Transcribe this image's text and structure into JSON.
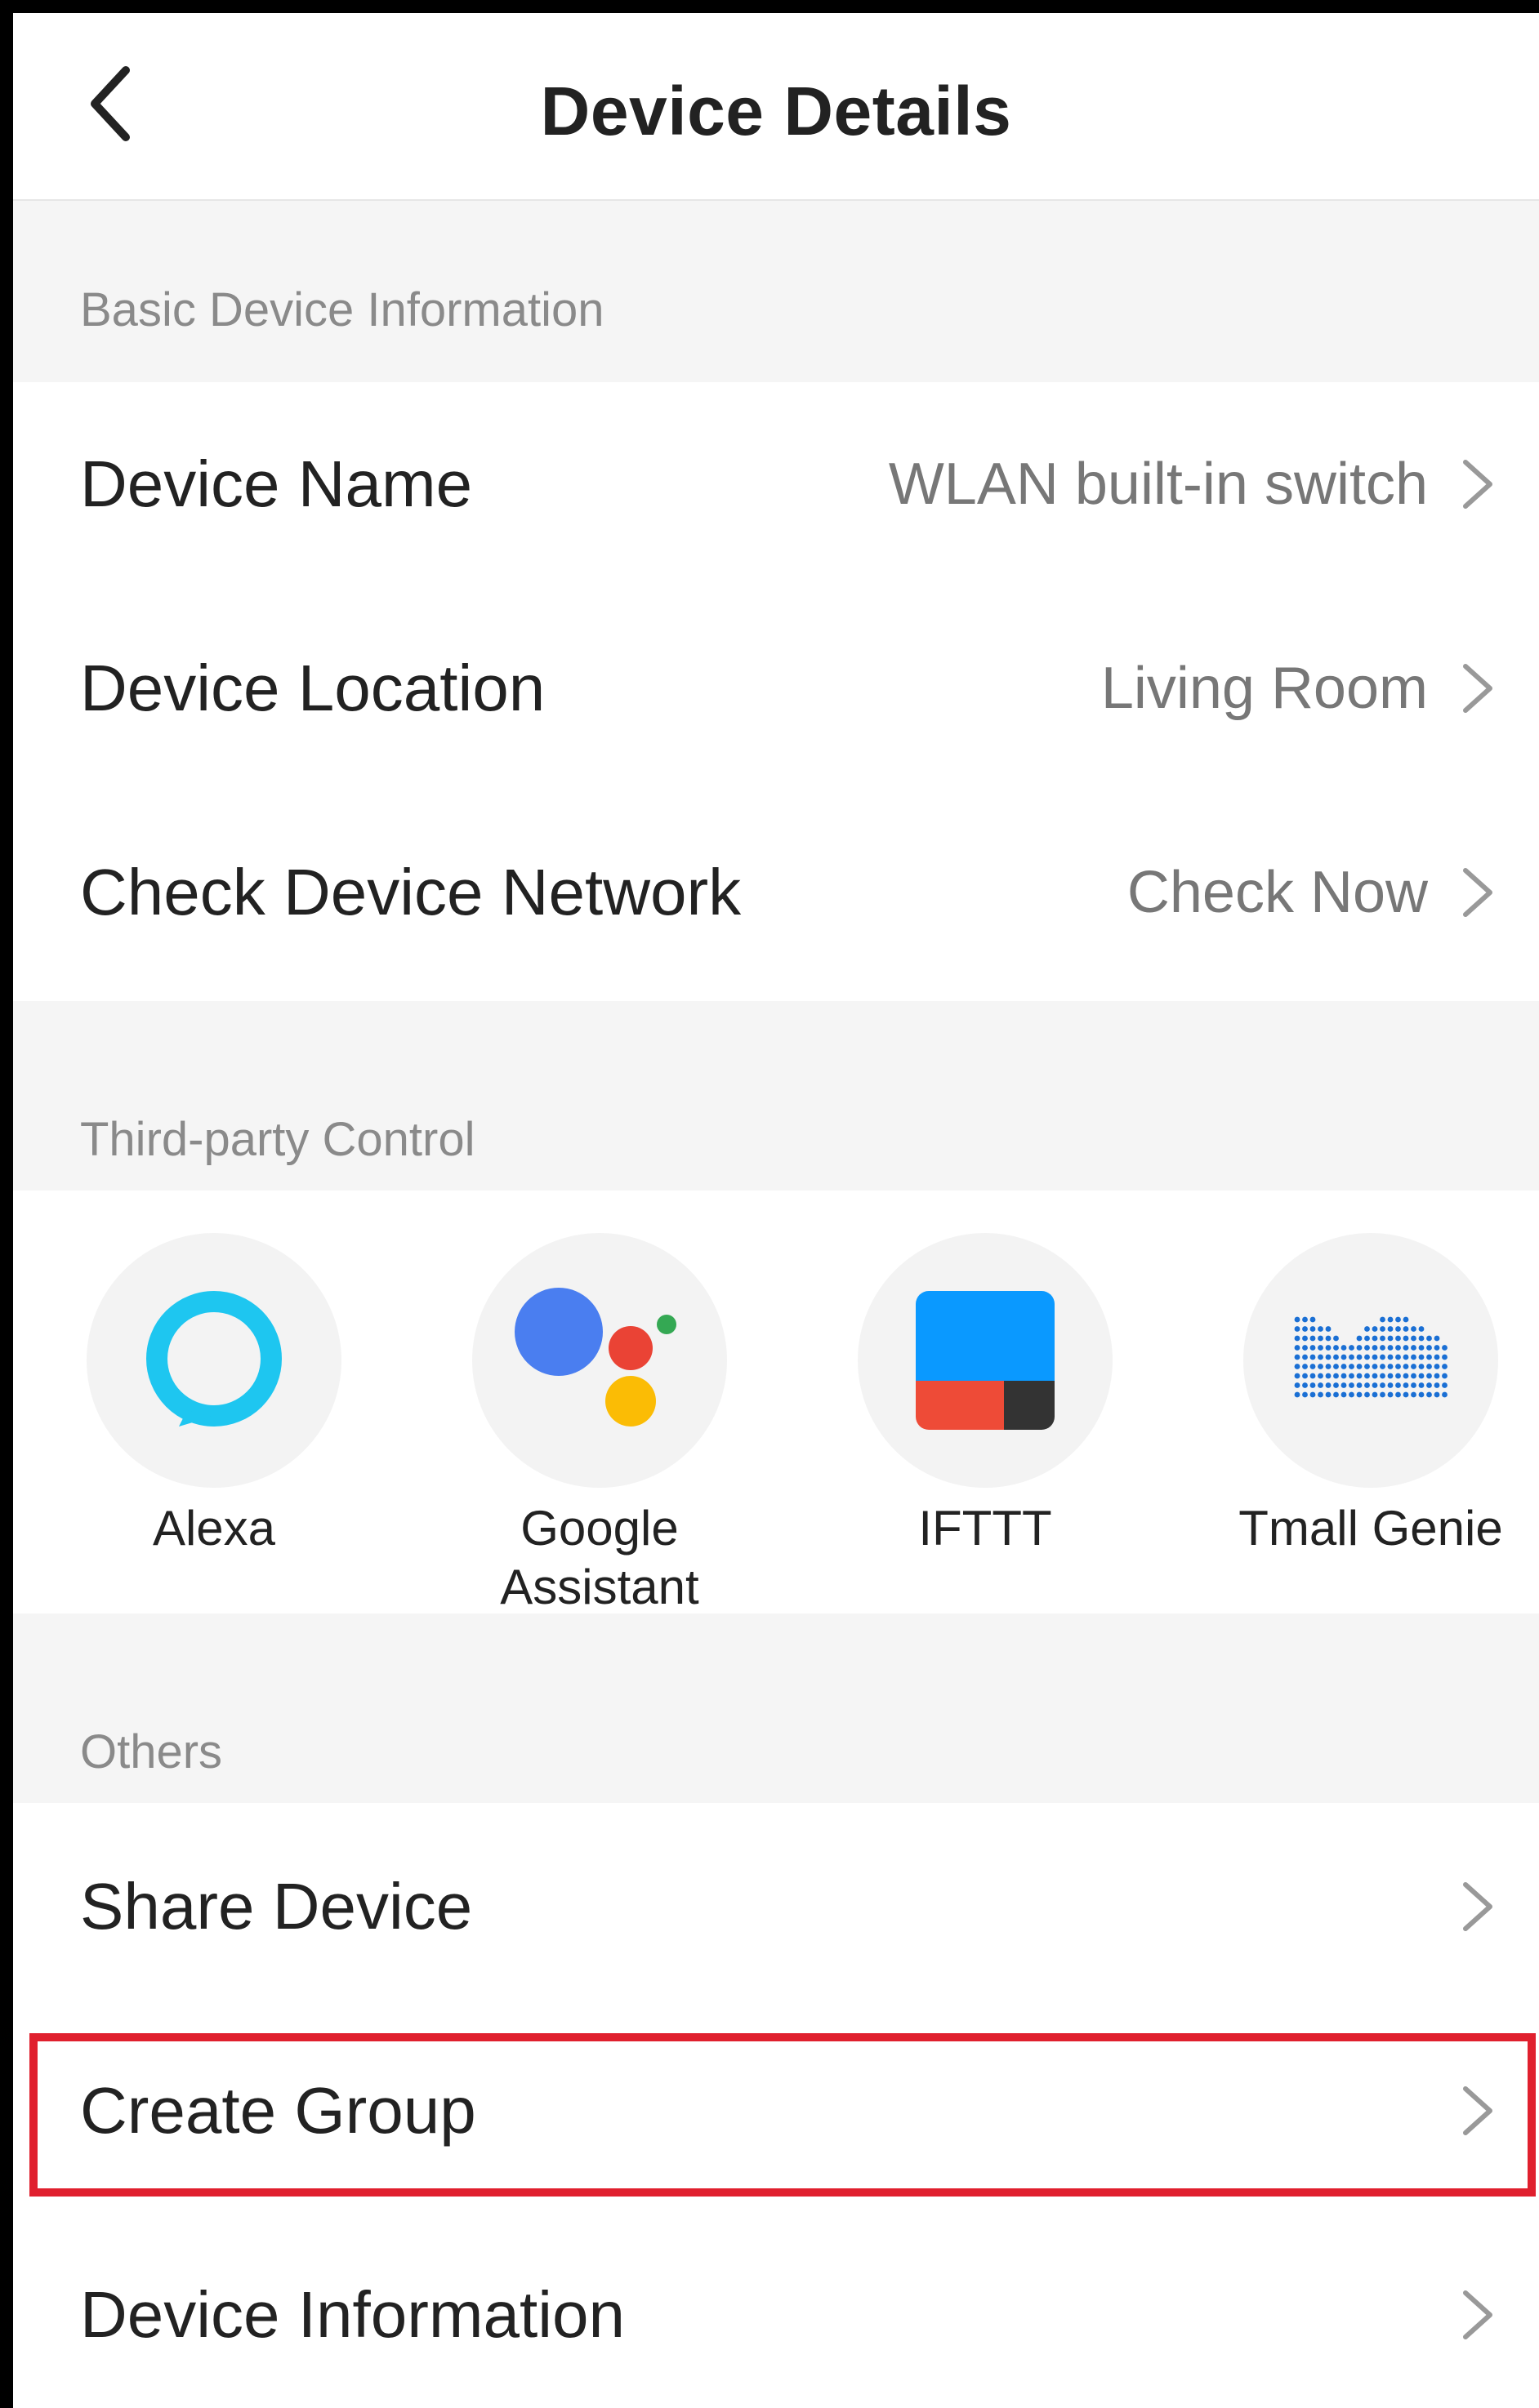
{
  "header": {
    "title": "Device Details",
    "back_icon": "chevron-left-icon"
  },
  "sections": {
    "basic": {
      "title": "Basic Device Information",
      "rows": [
        {
          "label": "Device Name",
          "value": "WLAN built-in switch"
        },
        {
          "label": "Device Location",
          "value": "Living Room"
        },
        {
          "label": "Check Device Network",
          "value": "Check Now"
        }
      ]
    },
    "third_party": {
      "title": "Third-party Control",
      "items": [
        {
          "label": "Alexa",
          "icon": "alexa-icon"
        },
        {
          "label_line1": "Google",
          "label_line2": "Assistant",
          "icon": "google-assistant-icon"
        },
        {
          "label": "IFTTT",
          "icon": "ifttt-icon"
        },
        {
          "label": "Tmall Genie",
          "icon": "tmall-genie-icon"
        }
      ]
    },
    "others": {
      "title": "Others",
      "rows": [
        {
          "label": "Share Device"
        },
        {
          "label": "Create Group"
        },
        {
          "label": "Device Information"
        }
      ]
    }
  },
  "colors": {
    "highlight": "#e0202e",
    "section_bg": "#f5f5f5",
    "alexa": "#1ec6f0",
    "google_blue": "#4a7ef0",
    "google_red": "#ea4335",
    "google_yellow": "#fbbc05",
    "google_green": "#34a853",
    "ifttt_blue": "#0a99ff",
    "ifttt_red": "#ee4b37",
    "ifttt_dark": "#333333",
    "tmall_blue": "#1a6fd4"
  }
}
